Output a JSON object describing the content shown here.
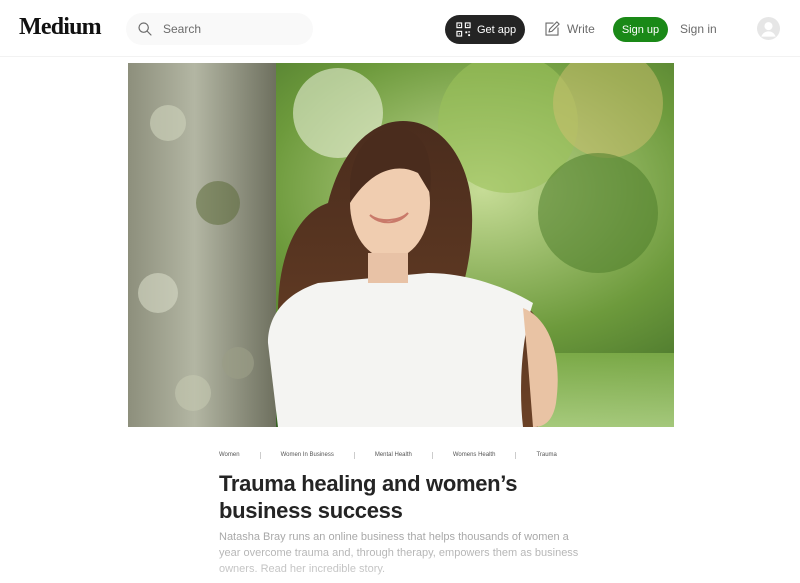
{
  "header": {
    "logo": "Medium",
    "search_placeholder": "Search",
    "get_app_label": "Get app",
    "write_label": "Write",
    "sign_up_label": "Sign up",
    "sign_in_label": "Sign in"
  },
  "article": {
    "tags": [
      "Women",
      "Women In Business",
      "Mental Health",
      "Womens Health",
      "Trauma"
    ],
    "title": "Trauma healing and women’s business success",
    "subtitle": "Natasha Bray runs an online business that helps thousands of women a year overcome trauma and, through therapy, empowers them as business owners. Read her incredible story."
  },
  "colors": {
    "brand_green": "#1a8917",
    "dark_button": "#242424",
    "muted_text": "#6b6b6b"
  },
  "icons": [
    "search-icon",
    "qr-code-icon",
    "write-icon",
    "user-avatar-icon"
  ]
}
